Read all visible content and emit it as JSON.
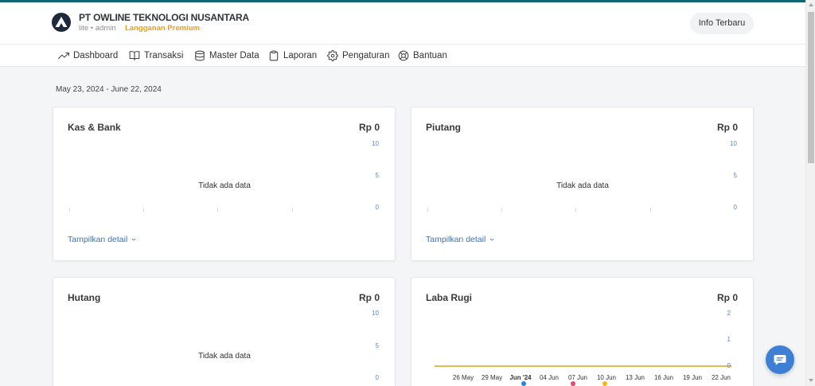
{
  "header": {
    "logo_icon": "company-logo-icon",
    "company_name": "PT OWLINE TEKNOLOGI NUSANTARA",
    "account_line": "lite • admin",
    "subscription": "Langganan Premium",
    "info_button": "Info Terbaru"
  },
  "nav": {
    "items": [
      {
        "label": "Dashboard",
        "icon": "trending-up-icon"
      },
      {
        "label": "Transaksi",
        "icon": "book-open-icon"
      },
      {
        "label": "Master Data",
        "icon": "database-icon"
      },
      {
        "label": "Laporan",
        "icon": "clipboard-icon"
      },
      {
        "label": "Pengaturan",
        "icon": "gear-icon"
      },
      {
        "label": "Bantuan",
        "icon": "lifebuoy-icon"
      }
    ]
  },
  "date_range": "May 23, 2024 - June 22, 2024",
  "cards": [
    {
      "total": "Rp 0",
      "detail_link": "Tampilkan detail",
      "detail_icon": "chevron-down-icon"
    },
    {
      "total": "Rp 0",
      "detail_link": "Tampilkan detail",
      "detail_icon": "chevron-down-icon"
    },
    {
      "total": "Rp 0"
    },
    {
      "total": "Rp 0"
    }
  ],
  "chat_button": {
    "icon": "chat-icon"
  },
  "colors": {
    "top_bar": "#0e6670",
    "page_background": "#f4f5f7",
    "logo": "#1d2a3c",
    "subscription": "#f39c12",
    "link": "#3b73b9",
    "axis_label": "#5b87c7",
    "chat_button": "#3e7fd6"
  },
  "chart_data": [
    {
      "type": "line",
      "title": "Kas & Bank",
      "ylim": [
        0,
        10
      ],
      "yticks": [
        10,
        5,
        0
      ],
      "grid": false,
      "series": [],
      "empty_message": "Tidak ada data"
    },
    {
      "type": "line",
      "title": "Piutang",
      "ylim": [
        0,
        10
      ],
      "yticks": [
        10,
        5,
        0
      ],
      "grid": false,
      "series": [],
      "empty_message": "Tidak ada data"
    },
    {
      "type": "line",
      "title": "Hutang",
      "ylim": [
        0,
        10
      ],
      "yticks": [
        10,
        5,
        0
      ],
      "grid": false,
      "series": [],
      "empty_message": "Tidak ada data"
    },
    {
      "type": "line",
      "title": "Laba Rugi",
      "ylim": [
        0,
        2
      ],
      "yticks": [
        2,
        1,
        0
      ],
      "grid": false,
      "x": [
        "26 May",
        "29 May",
        "Jun '24",
        "04 Jun",
        "07 Jun",
        "10 Jun",
        "13 Jun",
        "16 Jun",
        "19 Jun",
        "22 Jun"
      ],
      "series": [
        {
          "color": "#1e88e5",
          "values": [
            0,
            0,
            0,
            0,
            0,
            0,
            0,
            0,
            0,
            0
          ]
        },
        {
          "color": "#f0436a",
          "values": [
            0,
            0,
            0,
            0,
            0,
            0,
            0,
            0,
            0,
            0
          ]
        },
        {
          "color": "#f6b900",
          "values": [
            0,
            0,
            0,
            0,
            0,
            0,
            0,
            0,
            0,
            0
          ]
        }
      ],
      "legend": "bottom"
    }
  ]
}
